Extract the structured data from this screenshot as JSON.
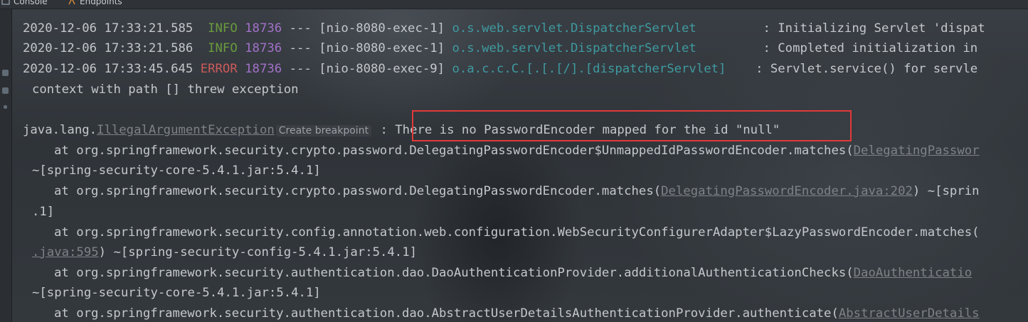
{
  "tabs": [
    {
      "label": "Console",
      "icon": "console-icon"
    },
    {
      "label": "Endpoints",
      "icon": "endpoints-icon"
    }
  ],
  "log": [
    {
      "ts": "2020-12-06 17:33:21.585",
      "level": "INFO",
      "pid": "18736",
      "sep": " --- ",
      "thread": "[nio-8080-exec-1]",
      "logger": "o.s.web.servlet.DispatcherServlet",
      "message": "Initializing Servlet 'dispat"
    },
    {
      "ts": "2020-12-06 17:33:21.586",
      "level": "INFO",
      "pid": "18736",
      "sep": " --- ",
      "thread": "[nio-8080-exec-1]",
      "logger": "o.s.web.servlet.DispatcherServlet",
      "message": "Completed initialization in"
    },
    {
      "ts": "2020-12-06 17:33:45.645",
      "level": "ERROR",
      "pid": "18736",
      "sep": " --- ",
      "thread": "[nio-8080-exec-9]",
      "logger": "o.a.c.c.C.[.[.[/].[dispatcherServlet]",
      "message": "Servlet.service() for servle"
    }
  ],
  "context_line": "context with path [] threw exception",
  "exception": {
    "prefix": "java.lang.",
    "class_link": "IllegalArgumentException",
    "breakpoint_label": "Create breakpoint",
    "separator": " : ",
    "message": "There is no PasswordEncoder mapped for the id \"null\""
  },
  "stack": [
    {
      "text": "at org.springframework.security.crypto.password.DelegatingPasswordEncoder$UnmappedIdPasswordEncoder.matches(",
      "link": "DelegatingPasswor",
      "suffix": ""
    },
    {
      "text": "~[spring-security-core-5.4.1.jar:5.4.1]",
      "link": "",
      "suffix": ""
    },
    {
      "text": "at org.springframework.security.crypto.password.DelegatingPasswordEncoder.matches(",
      "link": "DelegatingPasswordEncoder.java:202",
      "suffix": ") ~[sprin"
    },
    {
      "text": ".1]",
      "link": "",
      "suffix": ""
    },
    {
      "text": "at org.springframework.security.config.annotation.web.configuration.WebSecurityConfigurerAdapter$LazyPasswordEncoder.matches(",
      "link": "",
      "suffix": ""
    },
    {
      "text": "",
      "link": ".java:595",
      "suffix": ") ~[spring-security-config-5.4.1.jar:5.4.1]"
    },
    {
      "text": "at org.springframework.security.authentication.dao.DaoAuthenticationProvider.additionalAuthenticationChecks(",
      "link": "DaoAuthenticatio",
      "suffix": ""
    },
    {
      "text": "~[spring-security-core-5.4.1.jar:5.4.1]",
      "link": "",
      "suffix": ""
    },
    {
      "text": "at org.springframework.security.authentication.dao.AbstractUserDetailsAuthenticationProvider.authenticate(",
      "link": "AbstractUserDetails",
      "suffix": ""
    }
  ]
}
